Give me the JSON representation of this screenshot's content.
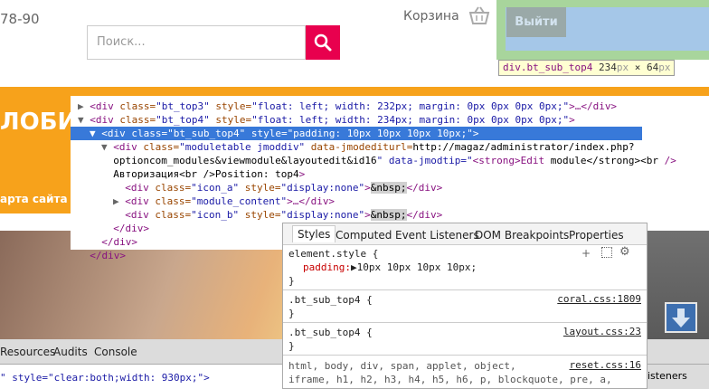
{
  "header": {
    "phone_fragment": "78-90",
    "search_placeholder": "Поиск...",
    "cart_label": "Корзина",
    "logout_label": "Выйти",
    "tooltip": {
      "selector": "div.bt_sub_top4",
      "width": "234",
      "height": "64",
      "unit": "px",
      "times": "×"
    }
  },
  "site": {
    "logo_fragment": "ЛОБИ",
    "map_link": "арта сайта"
  },
  "elements_panel": {
    "lines": [
      {
        "indent": 0,
        "arrow": "▶",
        "text": "<div class=\"bt_top3\" style=\"float: left; width: 232px; margin: 0px 0px 0px 0px;\">…</div>"
      },
      {
        "indent": 0,
        "arrow": "▼",
        "text": "<div class=\"bt_top4\" style=\"float: left; width: 234px; margin: 0px 0px 0px 0px;\">"
      },
      {
        "indent": 1,
        "arrow": "▼",
        "text": "<div class=\"bt_sub_top4\" style=\"padding: 10px 10px 10px 10px;\">"
      },
      {
        "indent": 2,
        "arrow": "▼",
        "text": "<div class=\"moduletable jmoddiv\" data-jmodediturl=\"http://magaz/administrator/index.php?"
      },
      {
        "indent": 2,
        "arrow": "",
        "text": "option=com_modules&view=module&layout=edit&id=16\" data-jmodtip=\"<strong>Edit module</strong><br />"
      },
      {
        "indent": 2,
        "arrow": "",
        "text": "Авторизация<br />Position: top4\">"
      },
      {
        "indent": 3,
        "arrow": "",
        "text": "<div class=\"icon_a\" style=\"display:none\">&nbsp;</div>"
      },
      {
        "indent": 3,
        "arrow": "▶",
        "text": "<div class=\"module_content\">…</div>"
      },
      {
        "indent": 3,
        "arrow": "",
        "text": "<div class=\"icon_b\" style=\"display:none\">&nbsp;</div>"
      },
      {
        "indent": 2,
        "arrow": "",
        "text": "</div>"
      },
      {
        "indent": 1,
        "arrow": "",
        "text": "</div>"
      },
      {
        "indent": 0,
        "arrow": "",
        "text": "</div>"
      }
    ]
  },
  "styles_panel": {
    "tabs": [
      "Styles",
      "Computed",
      "Event Listeners",
      "DOM Breakpoints",
      "Properties"
    ],
    "active_tab": "Styles",
    "element_style_selector": "element.style {",
    "padding_prop": "padding:",
    "padding_value": "10px 10px 10px 10px;",
    "close_brace": "}",
    "rules": [
      {
        "selector": ".bt_sub_top4 {",
        "source": "coral.css:1809"
      },
      {
        "selector": ".bt_sub_top4 {",
        "source": "layout.css:23"
      }
    ],
    "reset_selector_1": "html, body, div, span, applet, object,",
    "reset_selector_2": "iframe, h1, h2, h3, h4, h5, h6, p, blockquote, pre, a,",
    "reset_source": "reset.css:16"
  },
  "devtools": {
    "tabs": [
      "Resources",
      "Audits",
      "Console"
    ],
    "console_line": "\" style=\"clear:both;width: 930px;\">",
    "right_tab": "isteners"
  }
}
